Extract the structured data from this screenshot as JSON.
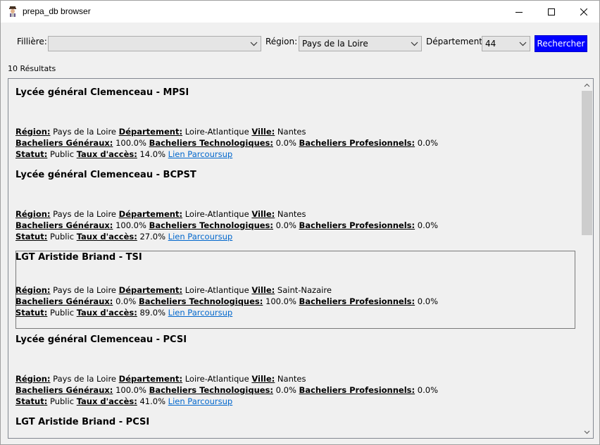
{
  "window": {
    "title": "prepa_db browser"
  },
  "filters": {
    "filiere": {
      "label": "Fillière:",
      "value": ""
    },
    "region": {
      "label": "Région:",
      "value": "Pays de la Loire"
    },
    "departement": {
      "label": "Département:",
      "value": "44"
    },
    "search_label": "Rechercher"
  },
  "results": {
    "count_text": "10 Résultats",
    "labels": {
      "region": "Région:",
      "departement": "Département:",
      "ville": "Ville:",
      "bac_gen": "Bacheliers Généraux:",
      "bac_tech": "Bacheliers Technologiques:",
      "bac_pro": "Bacheliers Profesionnels:",
      "statut": "Statut:",
      "taux": "Taux d'accès:",
      "link": "Lien Parcoursup"
    },
    "items": [
      {
        "name": "Lycée général Clemenceau - MPSI",
        "region": "Pays de la Loire",
        "departement": "Loire-Atlantique",
        "ville": "Nantes",
        "bac_gen": "100.0%",
        "bac_tech": "0.0%",
        "bac_pro": "0.0%",
        "statut": "Public",
        "taux": "14.0%"
      },
      {
        "name": "Lycée général Clemenceau - BCPST",
        "region": "Pays de la Loire",
        "departement": "Loire-Atlantique",
        "ville": "Nantes",
        "bac_gen": "100.0%",
        "bac_tech": "0.0%",
        "bac_pro": "0.0%",
        "statut": "Public",
        "taux": "27.0%"
      },
      {
        "name": "LGT Aristide Briand - TSI",
        "region": "Pays de la Loire",
        "departement": "Loire-Atlantique",
        "ville": "Saint-Nazaire",
        "bac_gen": "0.0%",
        "bac_tech": "100.0%",
        "bac_pro": "0.0%",
        "statut": "Public",
        "taux": "89.0%"
      },
      {
        "name": "Lycée général Clemenceau - PCSI",
        "region": "Pays de la Loire",
        "departement": "Loire-Atlantique",
        "ville": "Nantes",
        "bac_gen": "100.0%",
        "bac_tech": "0.0%",
        "bac_pro": "0.0%",
        "statut": "Public",
        "taux": "41.0%"
      },
      {
        "name": "LGT Aristide Briand - PCSI"
      }
    ]
  },
  "colors": {
    "search_button": "#0000ff",
    "link": "#0066cc"
  }
}
